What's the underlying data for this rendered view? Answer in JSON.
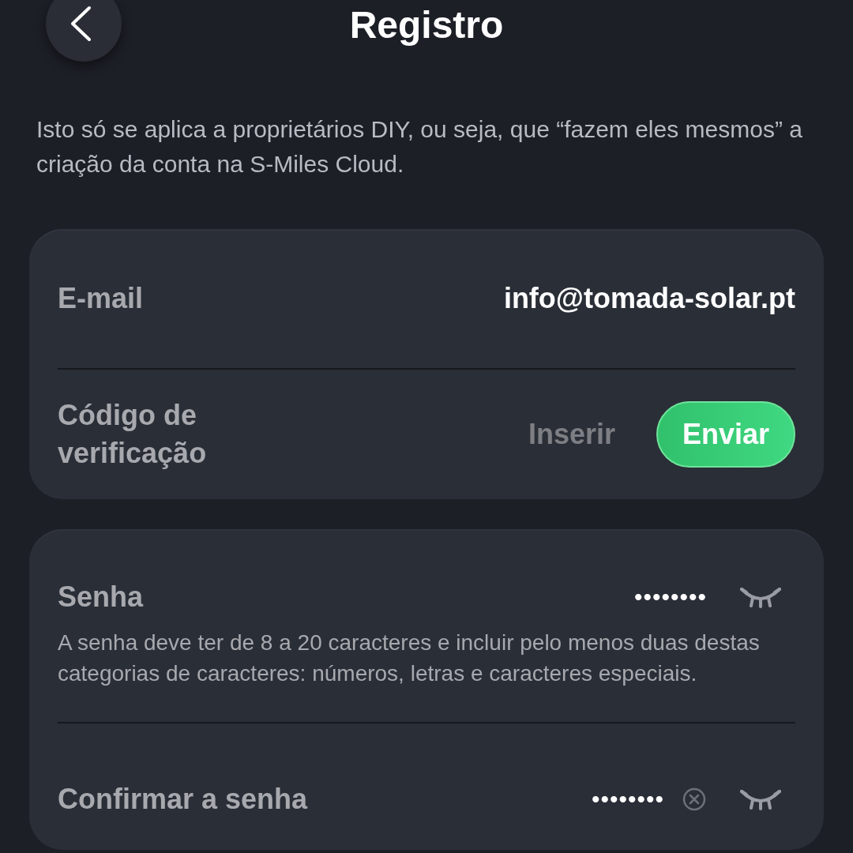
{
  "header": {
    "title": "Registro"
  },
  "intro": "Isto só se aplica a proprietários DIY, ou seja, que “fazem eles mesmos” a criação da conta na S-Miles Cloud.",
  "account_card": {
    "email": {
      "label": "E-mail",
      "value": "info@tomada-solar.pt"
    },
    "verification": {
      "label": "Código de verificação",
      "placeholder": "Inserir",
      "send_button": "Enviar"
    }
  },
  "password_card": {
    "password": {
      "label": "Senha",
      "value": "••••••••",
      "hint": "A senha deve ter de 8 a 20 caracteres e incluir pelo menos duas destas categorias de caracteres: números, letras e caracteres especiais."
    },
    "confirm": {
      "label": "Confirmar a senha",
      "value": "••••••••"
    }
  }
}
